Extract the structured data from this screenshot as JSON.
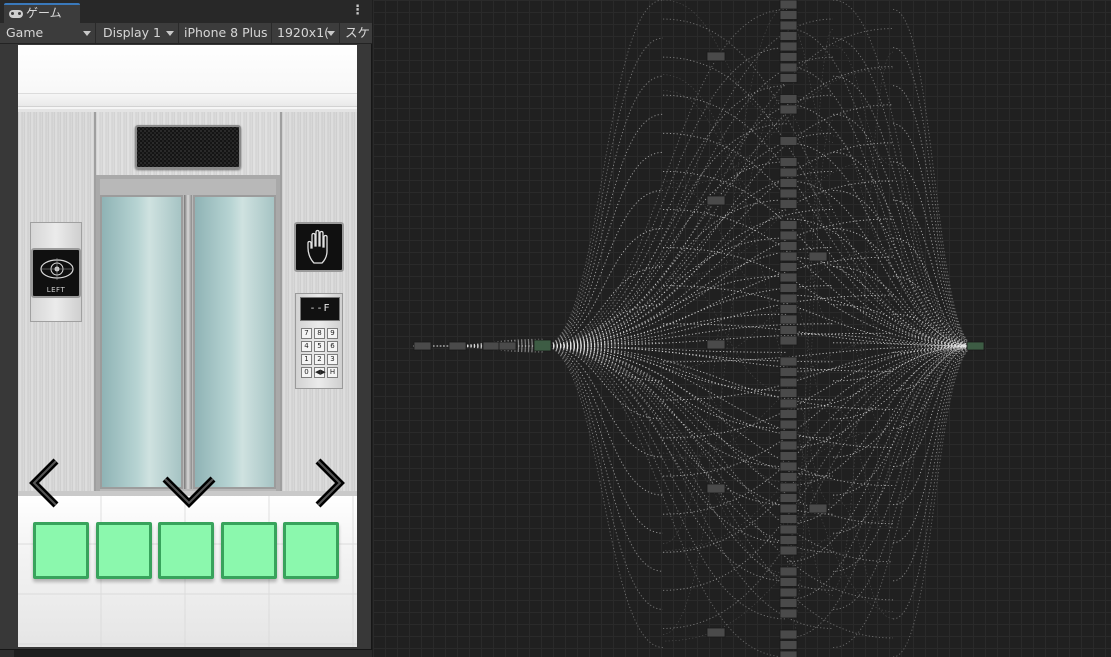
{
  "window": {
    "tab_title": "ゲーム",
    "menu_glyph": "⋮"
  },
  "toolbar": {
    "view_mode": "Game",
    "display": "Display 1",
    "device": "iPhone 8 Plus",
    "resolution": "1920x1(",
    "scale": "スケ"
  },
  "scene": {
    "eye_button_label": "LEFT",
    "keypad_display": "--F",
    "keypad_keys": [
      "7",
      "8",
      "9",
      "4",
      "5",
      "6",
      "1",
      "2",
      "3",
      "0",
      "◀▶",
      "H"
    ],
    "inventory_slot_count": 5,
    "slot_color": "#8bf8ad",
    "slot_border_color": "#38a35c"
  },
  "graph": {
    "background": "#202020",
    "node_color": "#4a4a4a",
    "edge_color": "#e8e8e8",
    "endpoint_node_color": "#3d5c44"
  }
}
